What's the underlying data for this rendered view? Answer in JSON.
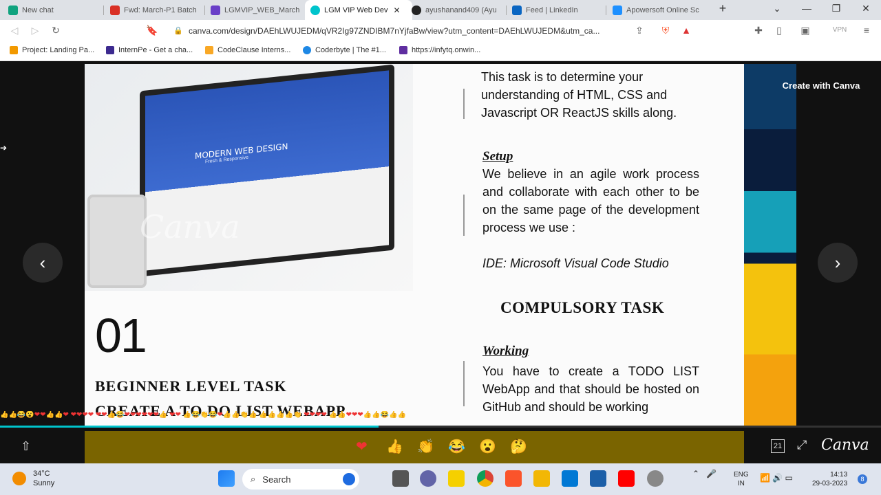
{
  "browser": {
    "tabs": [
      {
        "label": "New chat",
        "color": "#10a37f",
        "active": false
      },
      {
        "label": "Fwd: March-P1 Batch",
        "color": "#d93025",
        "active": false
      },
      {
        "label": "LGMVIP_WEB_March",
        "color": "#6a3fc8",
        "active": false
      },
      {
        "label": "LGM VIP Web Dev",
        "color": "#00c4cc",
        "active": true
      },
      {
        "label": "ayushanand409 (Ayu",
        "color": "#222222",
        "active": false
      },
      {
        "label": "Feed | LinkedIn",
        "color": "#0a66c2",
        "active": false
      },
      {
        "label": "Apowersoft Online Sc",
        "color": "#1e90ff",
        "active": false
      }
    ],
    "new_tab": "+",
    "url": "canva.com/design/DAEhLWUJEDM/qVR2Ig97ZNDIBM7nYjfaBw/view?utm_content=DAEhLWUJEDM&utm_ca...",
    "vpn_label": "VPN",
    "bookmarks": [
      {
        "label": "Project: Landing Pa...",
        "color": "#f29900"
      },
      {
        "label": "InternPe - Get a cha...",
        "color": "#3c2a8f"
      },
      {
        "label": "CodeClause Interns...",
        "color": "#f9a825"
      },
      {
        "label": "Coderbyte | The #1...",
        "color": "#1e88e5"
      },
      {
        "label": "https://infytq.onwin...",
        "color": "#5f2ea0"
      }
    ]
  },
  "slide": {
    "hero_title": "MODERN WEB DESIGN",
    "hero_subtitle": "Fresh & Responsive",
    "watermark": "Canva",
    "number": "01",
    "task_line1": "BEGINNER LEVEL TASK",
    "task_line2": "CREATE A TO DO LIST WEBAPP",
    "intro": "This task is to determine your understanding of HTML, CSS and Javascript OR ReactJS skills along.",
    "setup_heading": "Setup",
    "setup_body": "We believe in an agile work process and collaborate with each other to be on the same page of the development process we use :",
    "ide": "IDE: Microsoft Visual Code Studio",
    "compulsory": "COMPULSORY TASK",
    "working_heading": "Working",
    "working_body": "You have to create a TODO LIST WebApp and that should be hosted on GitHub and should be working"
  },
  "viewer": {
    "create_with_canva": "Create with Canva",
    "prev": "‹",
    "next": "›",
    "progress": 0.43,
    "page_count": "21",
    "canva_logo": "Canva",
    "reactions": [
      "❤",
      "👍",
      "👏",
      "😂",
      "😮",
      "🤔"
    ],
    "emoji_strip": "👍👍😂😮❤❤👍👍❤ ❤❤❤❤ ❤❤👍😂❤❤❤❤❤❤👍 ❤❤ 👍😂👏😂❤👍👍👏👍 👍👍👍👍👏 ❤❤❤❤ 👍👍❤❤❤👍👍😂👍👍"
  },
  "taskbar": {
    "temperature": "34°C",
    "condition": "Sunny",
    "search_label": "Search",
    "lang_line1": "ENG",
    "lang_line2": "IN",
    "time": "14:13",
    "date": "29-03-2023",
    "notifications": "8"
  }
}
